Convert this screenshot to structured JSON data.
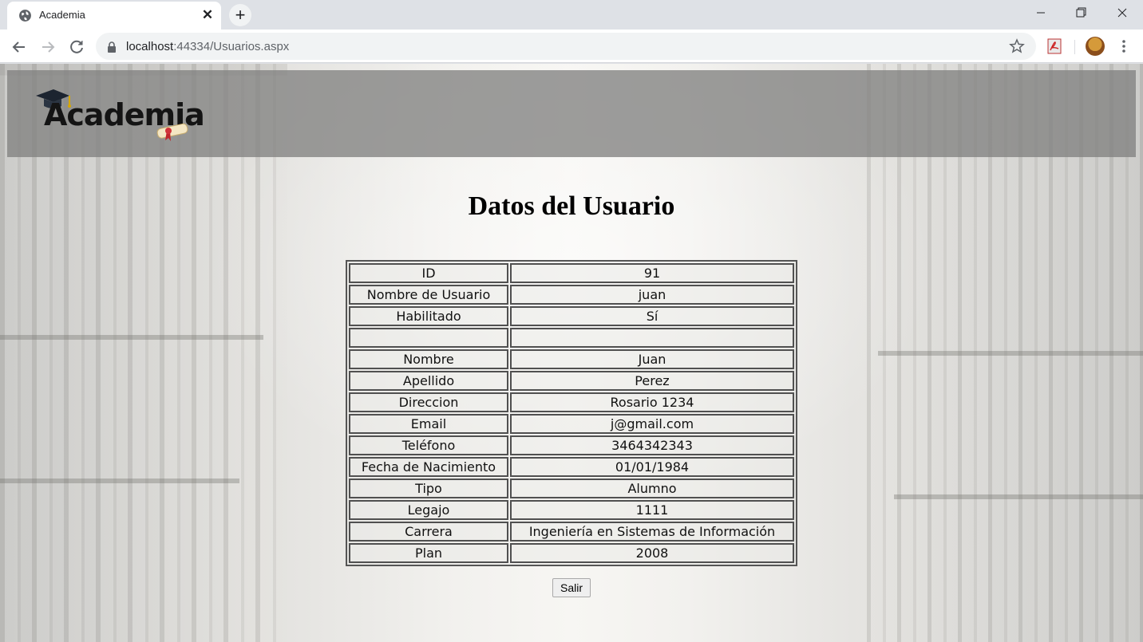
{
  "browser": {
    "tab_title": "Academia",
    "url_host": "localhost",
    "url_path": ":44334/Usuarios.aspx"
  },
  "header": {
    "logo_text": "Academia"
  },
  "page": {
    "title": "Datos del Usuario",
    "exit_button": "Salir"
  },
  "user_table": {
    "rows": [
      {
        "label": "ID",
        "value": "91"
      },
      {
        "label": "Nombre de Usuario",
        "value": "juan"
      },
      {
        "label": "Habilitado",
        "value": "Sí"
      },
      {
        "label": "",
        "value": ""
      },
      {
        "label": "Nombre",
        "value": "Juan"
      },
      {
        "label": "Apellido",
        "value": "Perez"
      },
      {
        "label": "Direccion",
        "value": "Rosario 1234"
      },
      {
        "label": "Email",
        "value": "j@gmail.com"
      },
      {
        "label": "Teléfono",
        "value": "3464342343"
      },
      {
        "label": "Fecha de Nacimiento",
        "value": "01/01/1984"
      },
      {
        "label": "Tipo",
        "value": "Alumno"
      },
      {
        "label": "Legajo",
        "value": "1111"
      },
      {
        "label": "Carrera",
        "value": "Ingeniería en Sistemas de Información"
      },
      {
        "label": "Plan",
        "value": "2008"
      }
    ]
  }
}
